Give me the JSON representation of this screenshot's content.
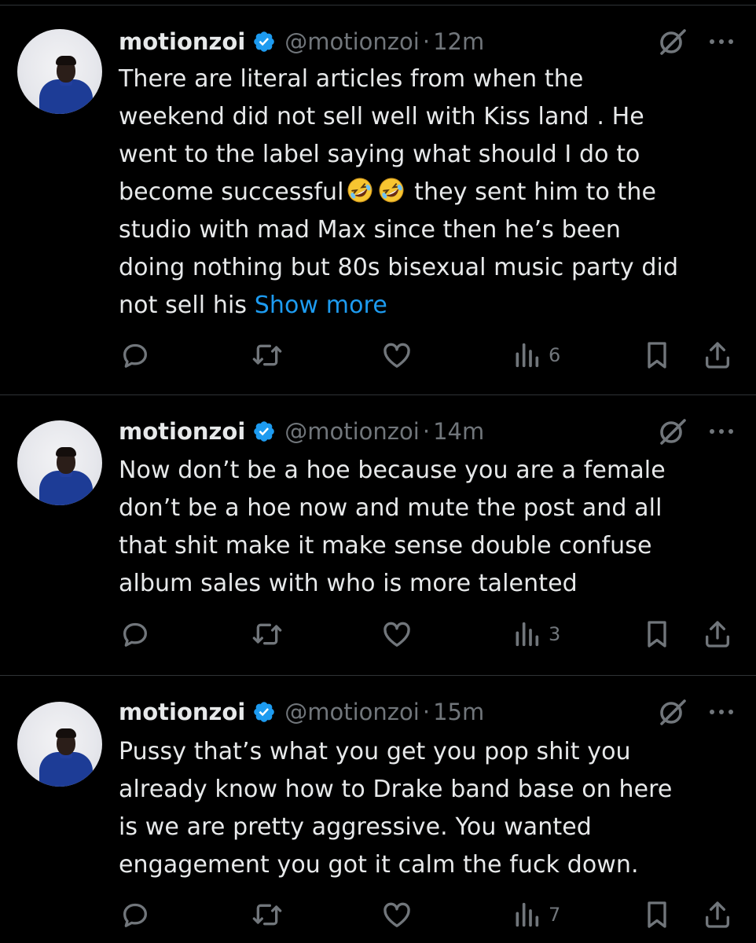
{
  "tweets": [
    {
      "display_name": "motionzoi",
      "handle": "@motionzoi",
      "separator": "·",
      "time": "12m",
      "lines": [
        "There are literal articles from when the",
        "weekend did not sell well with Kiss land . He",
        "went to the label saying what should I do to"
      ],
      "emoji_line_start": "become successful",
      "emoji_line_end": " they sent him to the",
      "lines_after": [
        "studio with mad Max since then he’s been",
        "doing nothing but 80s bisexual music party did"
      ],
      "last_line": "not sell his ",
      "show_more": "Show more",
      "views": "6",
      "emoji": "rolling-on-floor-laughing"
    },
    {
      "display_name": "motionzoi",
      "handle": "@motionzoi",
      "separator": "·",
      "time": "14m",
      "lines": [
        "Now don’t be a hoe because you are a female",
        "don’t be a hoe now and mute the post and all",
        "that shit make it make sense double confuse",
        "album sales with who is more talented"
      ],
      "views": "3"
    },
    {
      "display_name": "motionzoi",
      "handle": "@motionzoi",
      "separator": "·",
      "time": "15m",
      "lines": [
        "Pussy that’s what you get you pop shit you",
        "already know how to Drake band base on here",
        "is we are pretty aggressive. You wanted",
        "engagement you got it calm the fuck down."
      ],
      "views": "7"
    }
  ],
  "colors": {
    "background": "#000000",
    "text": "#e7e9ea",
    "muted": "#71767b",
    "link": "#1d9bf0",
    "verified": "#1d9bf0",
    "divider": "#2f3336"
  },
  "icons": [
    "reply-icon",
    "retweet-icon",
    "like-icon",
    "views-icon",
    "bookmark-icon",
    "share-icon",
    "grok-icon",
    "more-icon",
    "verified-badge-icon"
  ]
}
